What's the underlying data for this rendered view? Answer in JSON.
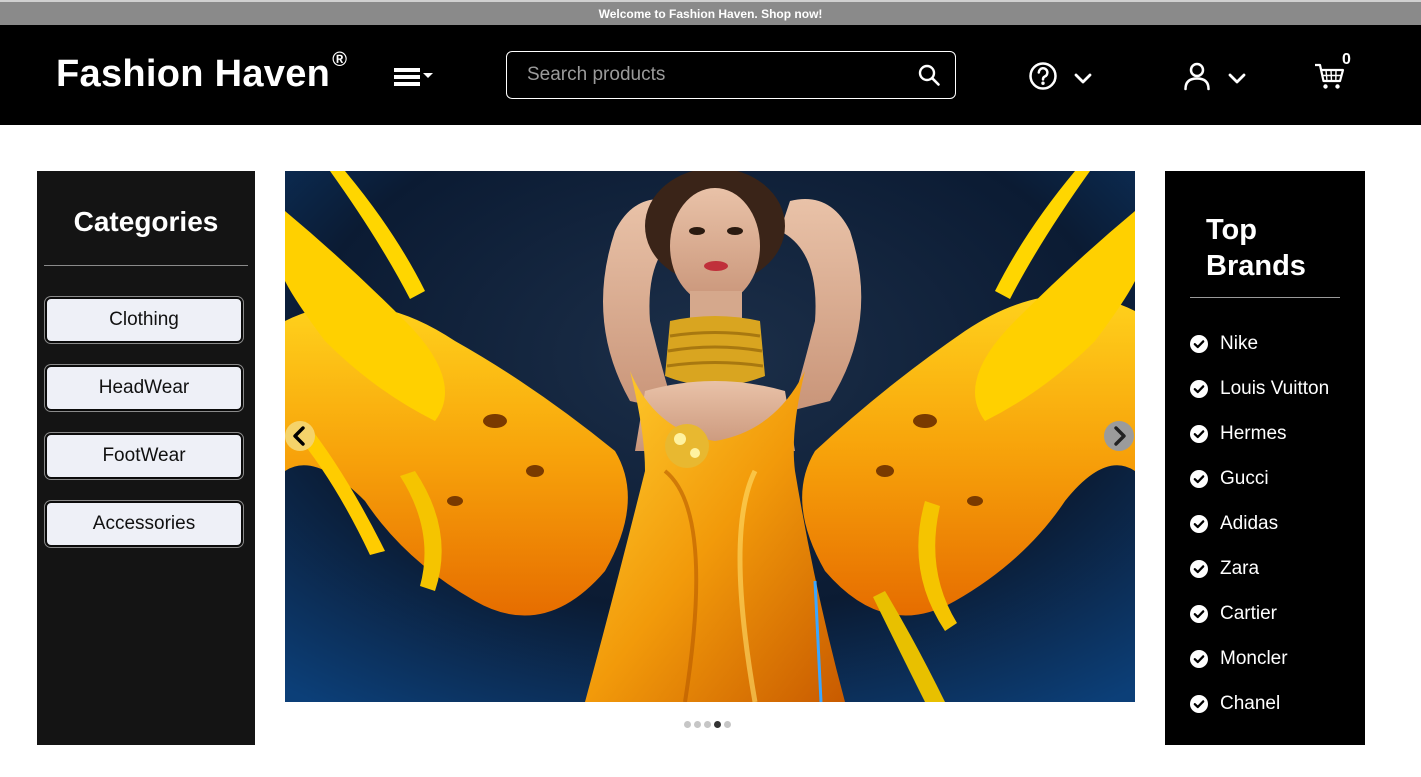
{
  "banner": {
    "text": "Welcome to Fashion Haven. Shop now!"
  },
  "header": {
    "logo": "Fashion Haven",
    "logo_mark": "®",
    "search_placeholder": "Search products",
    "cart_count": "0",
    "icons": [
      "menu-icon",
      "search-icon",
      "help-icon",
      "user-icon",
      "cart-icon",
      "chevron-down-icon"
    ]
  },
  "categories": {
    "title": "Categories",
    "items": [
      "Clothing",
      "HeadWear",
      "FootWear",
      "Accessories"
    ]
  },
  "carousel": {
    "slide_count": 5,
    "active_index": 3
  },
  "brands": {
    "title": "Top Brands",
    "items": [
      "Nike",
      "Louis Vuitton",
      "Hermes",
      "Gucci",
      "Adidas",
      "Zara",
      "Cartier",
      "Moncler",
      "Chanel"
    ]
  },
  "colors": {
    "header_bg": "#000000",
    "banner_bg": "#8a8a8a",
    "category_panel_bg": "#141414",
    "category_button_bg": "#eef0f7",
    "accent_gold": "#f5a800"
  }
}
